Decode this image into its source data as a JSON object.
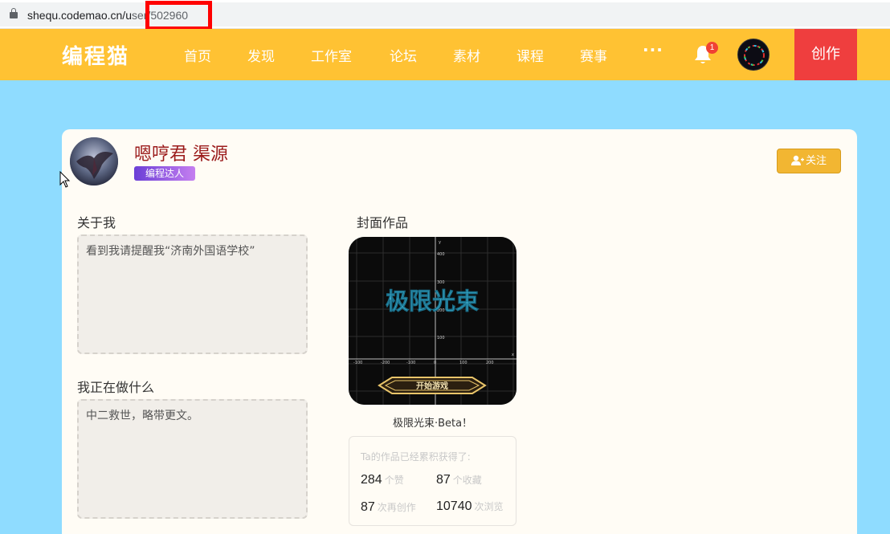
{
  "browser": {
    "url_host": "shequ.codemao.cn/u",
    "url_path": "ser/502960"
  },
  "nav": {
    "logo": "编程猫",
    "items": [
      "首页",
      "发现",
      "工作室",
      "论坛",
      "素材",
      "课程",
      "赛事"
    ],
    "more": "···",
    "notification_count": "1",
    "create_label": "创作"
  },
  "profile": {
    "name": "嗯哼君 渠源",
    "tag": "编程达人",
    "follow_label": "关注"
  },
  "about": {
    "title": "关于我",
    "text": "看到我请提醒我“济南外国语学校”"
  },
  "doing": {
    "title": "我正在做什么",
    "text": "中二救世，略带更文。"
  },
  "cover": {
    "title": "封面作品",
    "game_title": "极限光束",
    "start_button": "开始游戏",
    "work_name": "极限光束·Beta！",
    "axis_y": [
      "400",
      "300",
      "200",
      "100"
    ],
    "axis_x": [
      "-100",
      "-200",
      "-100",
      "0",
      "100",
      "200"
    ],
    "axis_x_label": "x",
    "axis_y_label": "y"
  },
  "stats": {
    "heading": "Ta的作品已经累积获得了:",
    "likes": "284",
    "likes_unit": "个赞",
    "favorites": "87",
    "favorites_unit": "个收藏",
    "remixes": "87",
    "remixes_unit": "次再创作",
    "views": "10740",
    "views_unit": "次浏览"
  },
  "colors": {
    "nav_bg": "#ffc233",
    "page_bg": "#8fdcff",
    "create_bg": "#ef3e3e",
    "name_color": "#9b1b1b",
    "follow_bg": "#f2b632"
  },
  "icons": [
    "lock-icon",
    "bell-icon",
    "user-plus-icon",
    "cursor-icon"
  ]
}
